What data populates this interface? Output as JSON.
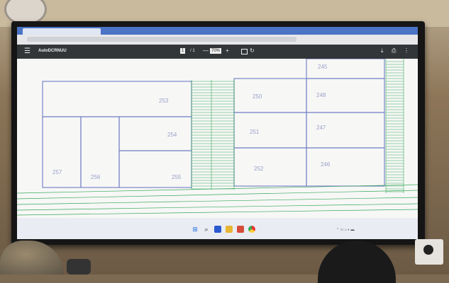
{
  "pdf_viewer": {
    "document_name": "AutoDCRNUU",
    "page_current": "1",
    "page_total": "/ 1",
    "zoom_minus": "—",
    "zoom_level": "70%",
    "zoom_plus": "+"
  },
  "drawing": {
    "blocks": [
      {
        "label": "253"
      },
      {
        "label": "254"
      },
      {
        "label": "255"
      },
      {
        "label": "256"
      },
      {
        "label": "257"
      },
      {
        "label": "250"
      },
      {
        "label": "251"
      },
      {
        "label": "252"
      },
      {
        "label": "248"
      },
      {
        "label": "247"
      },
      {
        "label": "246"
      },
      {
        "label": "245"
      }
    ],
    "line_color": "#7a86c8",
    "hatch_color": "#37a85a"
  },
  "taskbar": {
    "icons": [
      "windows-icon",
      "search-icon",
      "file-explorer-icon",
      "folder-icon",
      "app-icon",
      "chrome-icon"
    ]
  }
}
